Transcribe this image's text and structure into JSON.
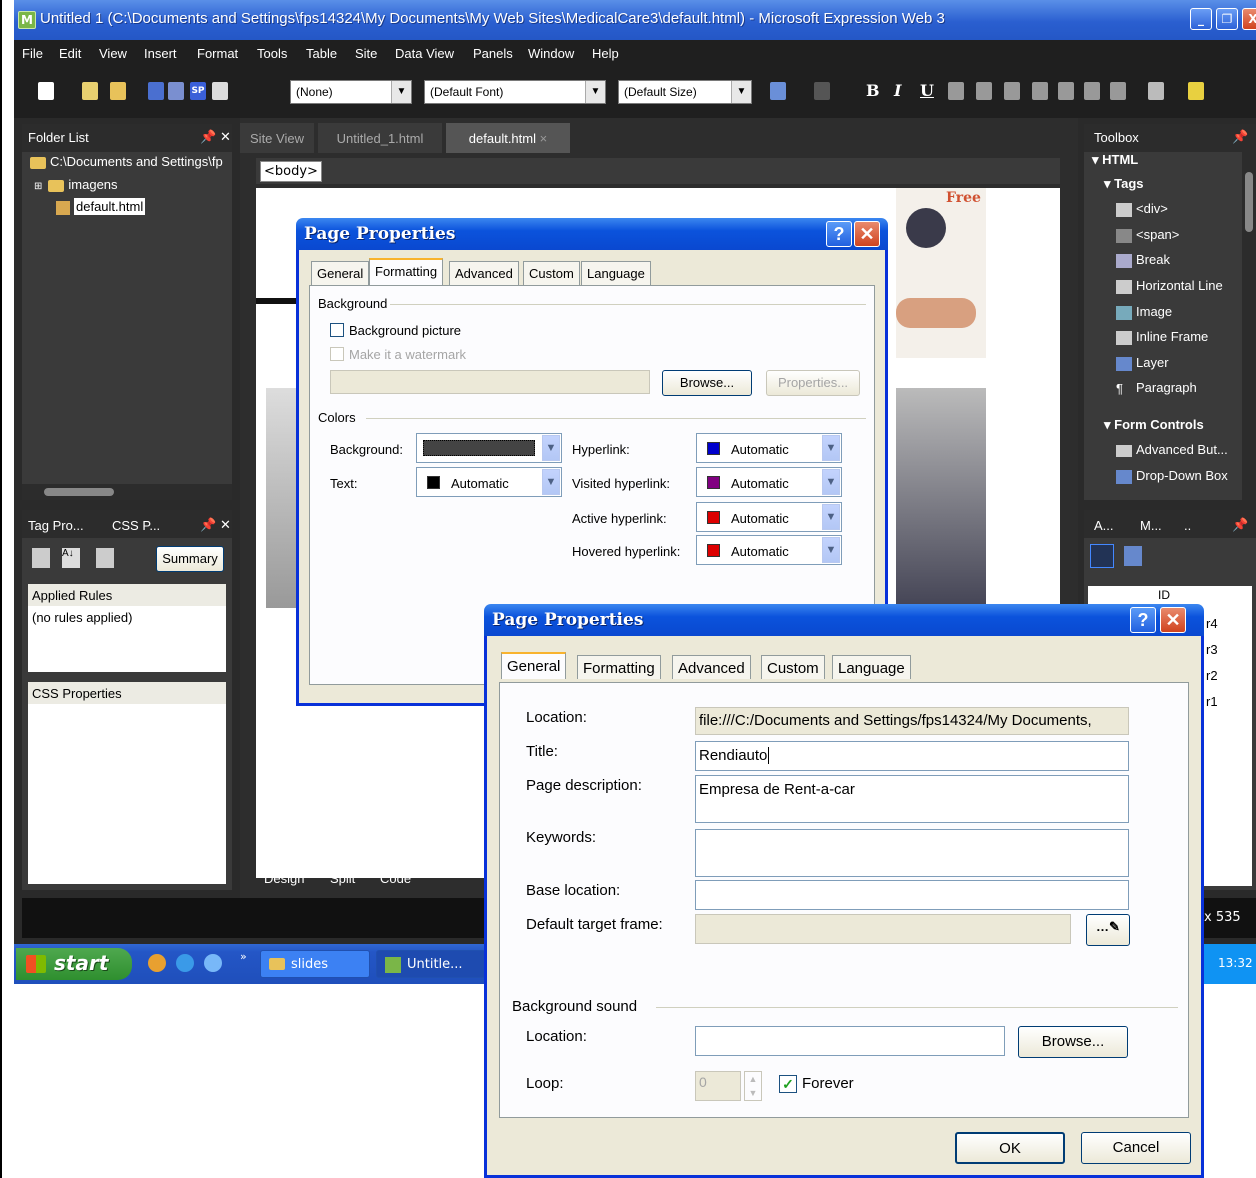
{
  "window": {
    "title": "Untitled 1 (C:\\Documents and Settings\\fps14324\\My Documents\\My Web Sites\\MedicalCare3\\default.html) - Microsoft Expression Web 3",
    "app_icon": "expression-web-icon"
  },
  "menu": [
    "File",
    "Edit",
    "View",
    "Insert",
    "Format",
    "Tools",
    "Table",
    "Site",
    "Data View",
    "Panels",
    "Window",
    "Help"
  ],
  "toolbar": {
    "style_combo": "(None)",
    "font_combo": "(Default Font)",
    "size_combo": "(Default Size)",
    "bold": "B",
    "italic": "I",
    "underline": "U"
  },
  "folder_list": {
    "title": "Folder List",
    "root": "C:\\Documents and Settings\\fp",
    "items": [
      "imagens",
      "default.html"
    ]
  },
  "tag_panel": {
    "tabs": [
      "Tag Pro...",
      "CSS P..."
    ],
    "summary_button": "Summary",
    "applied_rules_header": "Applied Rules",
    "applied_rules_value": "(no rules applied)",
    "css_properties_header": "CSS Properties"
  },
  "document": {
    "tabs": [
      "Site View",
      "Untitled_1.html",
      "default.html"
    ],
    "breadcrumb": "<body>",
    "view_tabs": [
      "Design",
      "Split",
      "Code"
    ],
    "status_size": "x 535",
    "banner_text": "Free"
  },
  "toolbox": {
    "title": "Toolbox",
    "section_html": "HTML",
    "section_tags": "Tags",
    "tags": [
      "<div>",
      "<span>",
      "Break",
      "Horizontal Line",
      "Image",
      "Inline Frame",
      "Layer",
      "Paragraph"
    ],
    "section_form": "Form Controls",
    "form_items": [
      "Advanced But...",
      "Drop-Down Box"
    ]
  },
  "lower_right_panel": {
    "tabs": [
      "A...",
      "M...",
      ".."
    ],
    "list_header": "ID",
    "rows": [
      "r4",
      "r3",
      "r2",
      "r1"
    ]
  },
  "dialog_formatting": {
    "title": "Page Properties",
    "tabs": [
      "General",
      "Formatting",
      "Advanced",
      "Custom",
      "Language"
    ],
    "active_tab": "Formatting",
    "background_group": "Background",
    "bg_picture_label": "Background picture",
    "watermark_label": "Make it a watermark",
    "browse_button": "Browse...",
    "properties_button": "Properties...",
    "colors_group": "Colors",
    "background_label": "Background:",
    "text_label": "Text:",
    "text_color": "Automatic",
    "hyperlink_label": "Hyperlink:",
    "hyperlink_color": "Automatic",
    "visited_label": "Visited hyperlink:",
    "visited_color": "Automatic",
    "active_label": "Active hyperlink:",
    "active_color": "Automatic",
    "hovered_label": "Hovered hyperlink:",
    "hovered_color": "Automatic",
    "swatches": {
      "text": "#000000",
      "hyperlink": "#0000cc",
      "visited": "#800080",
      "active": "#dd0000",
      "hovered": "#dd0000"
    }
  },
  "dialog_general": {
    "title": "Page Properties",
    "tabs": [
      "General",
      "Formatting",
      "Advanced",
      "Custom",
      "Language"
    ],
    "active_tab": "General",
    "location_label": "Location:",
    "location_value": "file:///C:/Documents and Settings/fps14324/My Documents,",
    "title_label": "Title:",
    "title_value": "Rendiauto",
    "description_label": "Page description:",
    "description_value": "Empresa de Rent-a-car",
    "keywords_label": "Keywords:",
    "keywords_value": "",
    "base_label": "Base location:",
    "base_value": "",
    "target_label": "Default target frame:",
    "target_value": "",
    "bg_sound_group": "Background sound",
    "sound_location_label": "Location:",
    "sound_location_value": "",
    "sound_browse_button": "Browse...",
    "loop_label": "Loop:",
    "loop_value": "0",
    "forever_label": "Forever",
    "forever_checked": true,
    "ok_button": "OK",
    "cancel_button": "Cancel"
  },
  "taskbar": {
    "start": "start",
    "items": [
      "slides",
      "Untitle..."
    ],
    "clock": "13:32"
  }
}
